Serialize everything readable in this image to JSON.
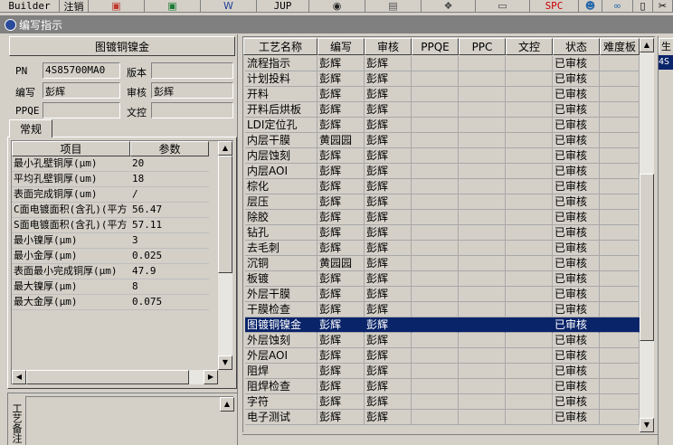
{
  "toolbar": {
    "items": [
      {
        "label": "Builder",
        "icon": ""
      },
      {
        "label": "注销",
        "icon": ""
      },
      {
        "label": "",
        "icon": "powerpoint-icon",
        "color": "#c0392b"
      },
      {
        "label": "",
        "icon": "excel-icon",
        "color": "#1e7b34"
      },
      {
        "label": "",
        "icon": "word-icon",
        "color": "#1f3f99"
      },
      {
        "label": "JUP",
        "icon": ""
      },
      {
        "label": "",
        "icon": "eye-icon",
        "color": "#222222"
      },
      {
        "label": "",
        "icon": "database-icon",
        "color": "#555555"
      },
      {
        "label": "",
        "icon": "network-icon",
        "color": "#444444"
      },
      {
        "label": "",
        "icon": "printer-icon",
        "color": "#444444"
      },
      {
        "label": "SPC",
        "icon": "",
        "color": "#cc0000"
      },
      {
        "label": "",
        "icon": "users-icon",
        "color": "#2266aa"
      },
      {
        "label": "",
        "icon": "link-icon",
        "color": "#2266aa"
      },
      {
        "label": "",
        "icon": "page-icon",
        "color": "#ffffff"
      },
      {
        "label": "",
        "icon": "scissors-icon",
        "color": "#000000"
      }
    ]
  },
  "window": {
    "title": "编写指示",
    "icon": "app-icon"
  },
  "left": {
    "title": "图镀铜镍金",
    "pn_label": "PN",
    "pn_value": "4S85700MA0",
    "version_label": "版本",
    "version_value": "",
    "author_label": "编写",
    "author_value": "彭辉",
    "reviewer_label": "审核",
    "reviewer_value": "彭辉",
    "ppqe_label": "PPQE",
    "ppqe_value": "",
    "wenkong_label": "文控",
    "wenkong_value": "",
    "tab_label": "常规",
    "notes_label": "工艺备注"
  },
  "params": {
    "headers": [
      "项目",
      "参数"
    ],
    "rows": [
      [
        "最小孔壁铜厚(μm)",
        "20"
      ],
      [
        "平均孔壁铜厚(um)",
        "18"
      ],
      [
        "表面完成铜厚(um)",
        "/"
      ],
      [
        "C面电镀面积(含孔)(平方",
        "56.47"
      ],
      [
        "S面电镀面积(含孔)(平方",
        "57.11"
      ],
      [
        "最小镍厚(μm)",
        "3"
      ],
      [
        "最小金厚(μm)",
        "0.025"
      ],
      [
        "表面最小完成铜厚(μm)",
        "47.9"
      ],
      [
        "最大镍厚(μm)",
        "8"
      ],
      [
        "最大金厚(μm)",
        "0.075"
      ]
    ]
  },
  "grid": {
    "headers": [
      "工艺名称",
      "编写",
      "审核",
      "PPQE",
      "PPC",
      "文控",
      "状态",
      "难度板"
    ],
    "selected_index": 17,
    "rows": [
      [
        "流程指示",
        "彭辉",
        "彭辉",
        "",
        "",
        "",
        "已审核",
        ""
      ],
      [
        "计划投料",
        "彭辉",
        "彭辉",
        "",
        "",
        "",
        "已审核",
        ""
      ],
      [
        "开料",
        "彭辉",
        "彭辉",
        "",
        "",
        "",
        "已审核",
        ""
      ],
      [
        "开料后烘板",
        "彭辉",
        "彭辉",
        "",
        "",
        "",
        "已审核",
        ""
      ],
      [
        "LDI定位孔",
        "彭辉",
        "彭辉",
        "",
        "",
        "",
        "已审核",
        ""
      ],
      [
        "内层干膜",
        "黄园园",
        "彭辉",
        "",
        "",
        "",
        "已审核",
        ""
      ],
      [
        "内层蚀刻",
        "彭辉",
        "彭辉",
        "",
        "",
        "",
        "已审核",
        ""
      ],
      [
        "内层AOI",
        "彭辉",
        "彭辉",
        "",
        "",
        "",
        "已审核",
        ""
      ],
      [
        "棕化",
        "彭辉",
        "彭辉",
        "",
        "",
        "",
        "已审核",
        ""
      ],
      [
        "层压",
        "彭辉",
        "彭辉",
        "",
        "",
        "",
        "已审核",
        ""
      ],
      [
        "除胶",
        "彭辉",
        "彭辉",
        "",
        "",
        "",
        "已审核",
        ""
      ],
      [
        "钻孔",
        "彭辉",
        "彭辉",
        "",
        "",
        "",
        "已审核",
        ""
      ],
      [
        "去毛刺",
        "彭辉",
        "彭辉",
        "",
        "",
        "",
        "已审核",
        ""
      ],
      [
        "沉铜",
        "黄园园",
        "彭辉",
        "",
        "",
        "",
        "已审核",
        ""
      ],
      [
        "板镀",
        "彭辉",
        "彭辉",
        "",
        "",
        "",
        "已审核",
        ""
      ],
      [
        "外层干膜",
        "彭辉",
        "彭辉",
        "",
        "",
        "",
        "已审核",
        ""
      ],
      [
        "干膜检查",
        "彭辉",
        "彭辉",
        "",
        "",
        "",
        "已审核",
        ""
      ],
      [
        "图镀铜镍金",
        "彭辉",
        "彭辉",
        "",
        "",
        "",
        "已审核",
        ""
      ],
      [
        "外层蚀刻",
        "彭辉",
        "彭辉",
        "",
        "",
        "",
        "已审核",
        ""
      ],
      [
        "外层AOI",
        "彭辉",
        "彭辉",
        "",
        "",
        "",
        "已审核",
        ""
      ],
      [
        "阻焊",
        "彭辉",
        "彭辉",
        "",
        "",
        "",
        "已审核",
        ""
      ],
      [
        "阻焊检查",
        "彭辉",
        "彭辉",
        "",
        "",
        "",
        "已审核",
        ""
      ],
      [
        "字符",
        "彭辉",
        "彭辉",
        "",
        "",
        "",
        "已审核",
        ""
      ],
      [
        "电子测试",
        "彭辉",
        "彭辉",
        "",
        "",
        "",
        "已审核",
        ""
      ]
    ]
  },
  "right_strip": {
    "header": "生",
    "cell": "4S"
  }
}
